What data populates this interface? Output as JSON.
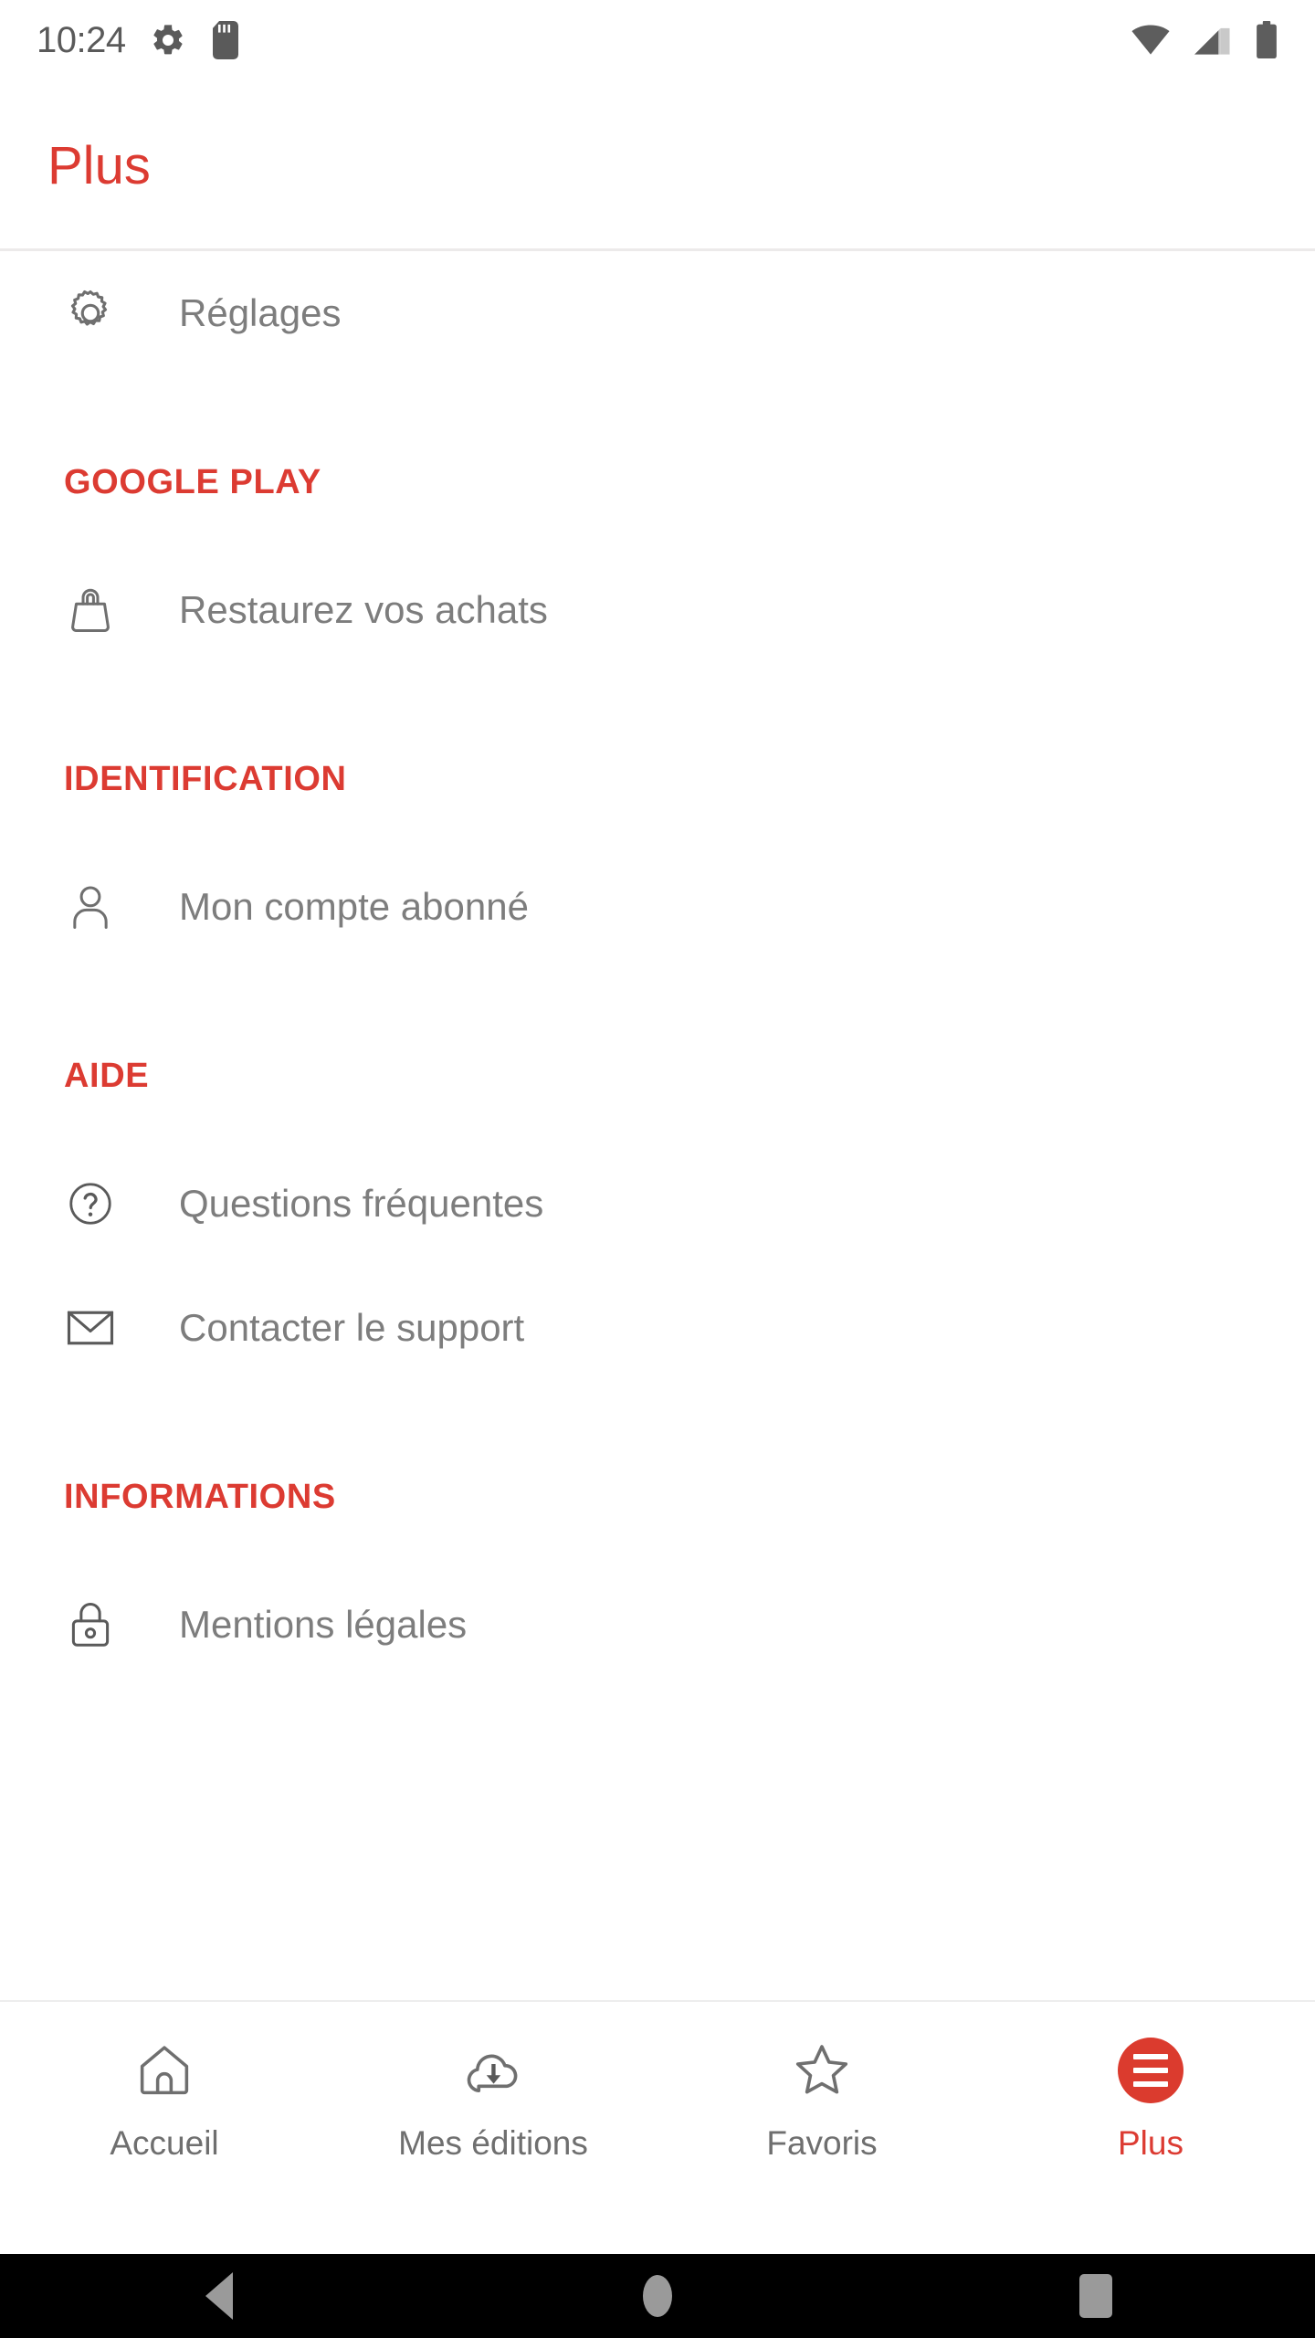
{
  "status_bar": {
    "time": "10:24",
    "left_icons": [
      "settings-gear-icon",
      "sd-card-icon"
    ],
    "right_icons": [
      "wifi-icon",
      "cellular-signal-icon",
      "battery-full-icon"
    ]
  },
  "header": {
    "title": "Plus",
    "title_color": "#DC3B32"
  },
  "content": {
    "top_items": [
      {
        "icon": "gear-icon",
        "label": "Réglages"
      }
    ],
    "sections": [
      {
        "heading": "GOOGLE PLAY",
        "items": [
          {
            "icon": "shopping-bag-icon",
            "label": "Restaurez vos achats"
          }
        ]
      },
      {
        "heading": "IDENTIFICATION",
        "items": [
          {
            "icon": "person-icon",
            "label": "Mon compte abonné"
          }
        ]
      },
      {
        "heading": "AIDE",
        "items": [
          {
            "icon": "question-circle-icon",
            "label": "Questions fréquentes"
          },
          {
            "icon": "envelope-icon",
            "label": "Contacter le support"
          }
        ]
      },
      {
        "heading": "INFORMATIONS",
        "items": [
          {
            "icon": "lock-icon",
            "label": "Mentions légales"
          }
        ]
      }
    ]
  },
  "tab_bar": {
    "accent_color": "#DB3B2E",
    "inactive_color": "#6f6f6f",
    "tabs": [
      {
        "icon": "home-icon",
        "label": "Accueil",
        "active": false
      },
      {
        "icon": "cloud-download-icon",
        "label": "Mes éditions",
        "active": false
      },
      {
        "icon": "star-icon",
        "label": "Favoris",
        "active": false
      },
      {
        "icon": "hamburger-menu-icon",
        "label": "Plus",
        "active": true
      }
    ]
  },
  "android_nav": {
    "buttons": [
      "back-button",
      "home-button",
      "recent-apps-button"
    ]
  }
}
